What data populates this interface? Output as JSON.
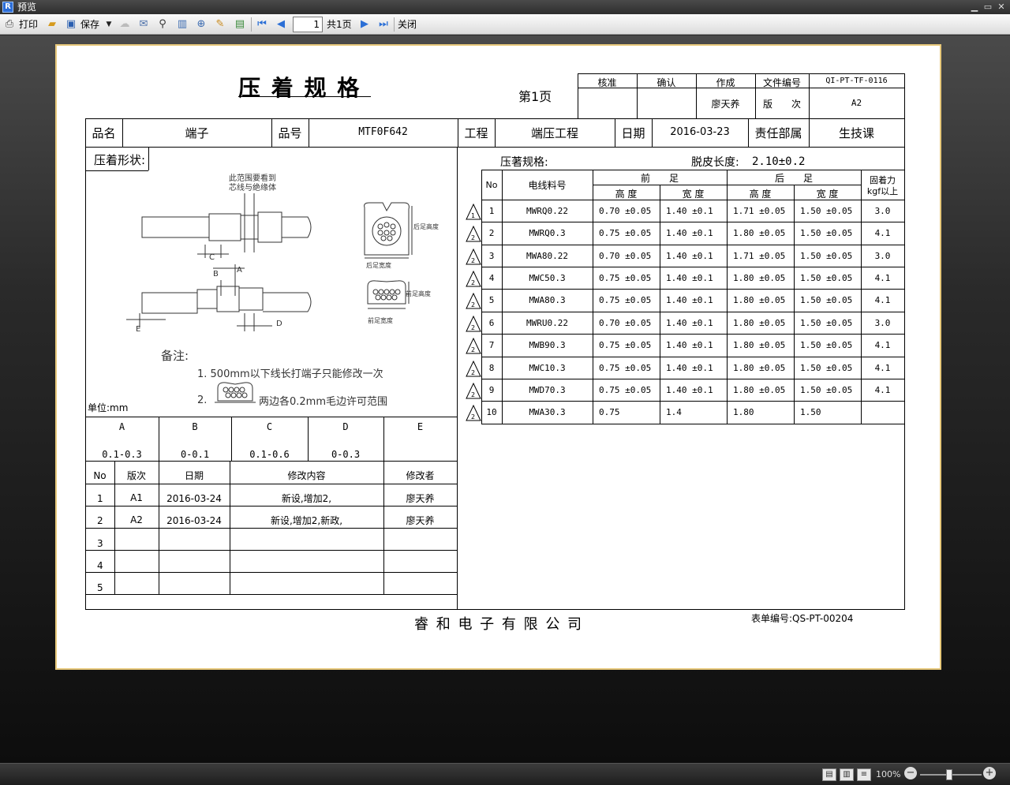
{
  "window": {
    "title": "预览",
    "app_icon": "R"
  },
  "toolbar": {
    "print": "打印",
    "save": "保存",
    "page_value": "1",
    "page_total": "共1页",
    "close": "关闭"
  },
  "doc": {
    "title": "压 着 规 格",
    "page_label": "第1页",
    "approval": {
      "h1": "核准",
      "h2": "确认",
      "h3": "作成",
      "h4": "文件编号",
      "h5": "QI-PT-TF-0116",
      "author": "廖天养",
      "rev_label": "版　　次",
      "rev": "A2"
    },
    "info": {
      "name_label": "品名",
      "name": "端子",
      "part_label": "品号",
      "part": "MTF0F642",
      "process_label": "工程",
      "process": "端压工程",
      "date_label": "日期",
      "date": "2016-03-23",
      "dept_label": "责任部属",
      "dept": "生技课"
    },
    "shape_label": "压着形状:",
    "diagram": {
      "note_top1": "此范围要看到",
      "note_top2": "芯线与绝缘体",
      "a": "A",
      "b": "B",
      "c": "C",
      "d": "D",
      "e": "E",
      "rear_h": "后足高度",
      "rear_w": "后足宽度",
      "front_h": "前足高度",
      "front_w": "前足宽度"
    },
    "notes_title": "备注:",
    "note1": "1.  500mm以下线长打端子只能修改一次",
    "note2_num": "2.",
    "note2": "两边各0.2mm毛边许可范围",
    "unit": "单位:mm",
    "dims": {
      "headers": [
        "A",
        "B",
        "C",
        "D",
        "E"
      ],
      "values": [
        "0.1-0.3",
        "0-0.1",
        "0.1-0.6",
        "0-0.3",
        ""
      ]
    },
    "revisions": {
      "headers": [
        "No",
        "版次",
        "日期",
        "修改内容",
        "修改者"
      ],
      "rows": [
        {
          "no": "1",
          "ver": "A1",
          "date": "2016-03-24",
          "content": "新设,增加2,",
          "by": "廖天养"
        },
        {
          "no": "2",
          "ver": "A2",
          "date": "2016-03-24",
          "content": "新设,增加2,新政,",
          "by": "廖天养"
        },
        {
          "no": "3",
          "ver": "",
          "date": "",
          "content": "",
          "by": ""
        },
        {
          "no": "4",
          "ver": "",
          "date": "",
          "content": "",
          "by": ""
        },
        {
          "no": "5",
          "ver": "",
          "date": "",
          "content": "",
          "by": ""
        }
      ]
    },
    "spec": {
      "label": "压著规格:",
      "strip_label": "脱皮长度:",
      "strip_value": "2.10±0.2",
      "h_no": "No",
      "h_wire": "电线料号",
      "h_front": "前　　足",
      "h_rear": "后　　足",
      "h_height": "高 度",
      "h_width": "宽 度",
      "h_force1": "固着力",
      "h_force2": "kgf以上",
      "rows": [
        {
          "no": "1",
          "wire": "MWRQ0.22",
          "fh": "0.70 ±0.05",
          "fw": "1.40 ±0.1",
          "rh": "1.71 ±0.05",
          "rw": "1.50 ±0.05",
          "f": "3.0"
        },
        {
          "no": "2",
          "wire": "MWRQ0.3",
          "fh": "0.75 ±0.05",
          "fw": "1.40 ±0.1",
          "rh": "1.80 ±0.05",
          "rw": "1.50 ±0.05",
          "f": "4.1"
        },
        {
          "no": "3",
          "wire": "MWA80.22",
          "fh": "0.70 ±0.05",
          "fw": "1.40 ±0.1",
          "rh": "1.71 ±0.05",
          "rw": "1.50 ±0.05",
          "f": "3.0"
        },
        {
          "no": "4",
          "wire": "MWC50.3",
          "fh": "0.75 ±0.05",
          "fw": "1.40 ±0.1",
          "rh": "1.80 ±0.05",
          "rw": "1.50 ±0.05",
          "f": "4.1"
        },
        {
          "no": "5",
          "wire": "MWA80.3",
          "fh": "0.75 ±0.05",
          "fw": "1.40 ±0.1",
          "rh": "1.80 ±0.05",
          "rw": "1.50 ±0.05",
          "f": "4.1"
        },
        {
          "no": "6",
          "wire": "MWRU0.22",
          "fh": "0.70 ±0.05",
          "fw": "1.40 ±0.1",
          "rh": "1.80 ±0.05",
          "rw": "1.50 ±0.05",
          "f": "3.0"
        },
        {
          "no": "7",
          "wire": "MWB90.3",
          "fh": "0.75 ±0.05",
          "fw": "1.40 ±0.1",
          "rh": "1.80 ±0.05",
          "rw": "1.50 ±0.05",
          "f": "4.1"
        },
        {
          "no": "8",
          "wire": "MWC10.3",
          "fh": "0.75 ±0.05",
          "fw": "1.40 ±0.1",
          "rh": "1.80 ±0.05",
          "rw": "1.50 ±0.05",
          "f": "4.1"
        },
        {
          "no": "9",
          "wire": "MWD70.3",
          "fh": "0.75 ±0.05",
          "fw": "1.40 ±0.1",
          "rh": "1.80 ±0.05",
          "rw": "1.50 ±0.05",
          "f": "4.1"
        },
        {
          "no": "10",
          "wire": "MWA30.3",
          "fh": "0.75",
          "fw": "1.4",
          "rh": "1.80",
          "rw": "1.50",
          "f": ""
        }
      ],
      "rev_marks": [
        "1",
        "2",
        "2",
        "2",
        "2",
        "2",
        "2",
        "2",
        "2",
        "2"
      ]
    },
    "company": "睿 和 电 子 有 限 公 司",
    "form_no": "表单编号:QS-PT-00204"
  },
  "status": {
    "zoom": "100%"
  },
  "colors": {
    "paper_border": "#e7c87a",
    "titlebar": "#3a3a3a"
  }
}
